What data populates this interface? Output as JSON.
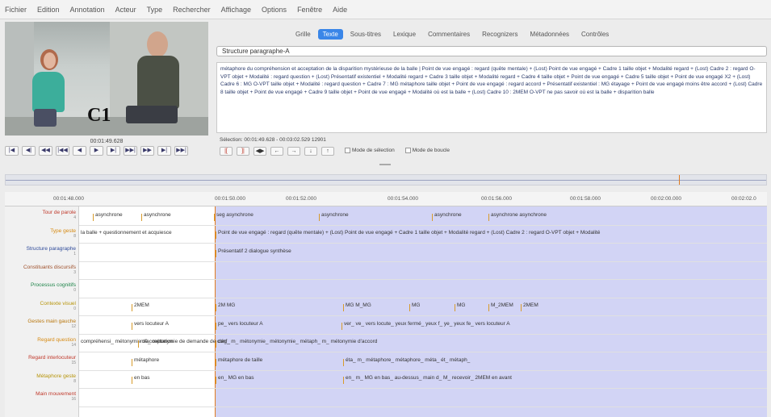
{
  "menu": [
    "Fichier",
    "Edition",
    "Annotation",
    "Acteur",
    "Type",
    "Rechercher",
    "Affichage",
    "Options",
    "Fenêtre",
    "Aide"
  ],
  "video": {
    "caption": "C1",
    "time": "00:01:49.628"
  },
  "transport": [
    "|◀",
    "◀|",
    "◀◀",
    "|◀◀",
    "◀",
    "▶",
    "▶|",
    "▶▶|",
    "▶▶",
    "▶|",
    "▶▶|"
  ],
  "tabs": [
    {
      "label": "Grille",
      "active": false
    },
    {
      "label": "Texte",
      "active": true
    },
    {
      "label": "Sous-titres",
      "active": false
    },
    {
      "label": "Lexique",
      "active": false
    },
    {
      "label": "Commentaires",
      "active": false
    },
    {
      "label": "Recognizers",
      "active": false
    },
    {
      "label": "Métadonnées",
      "active": false
    },
    {
      "label": "Contrôles",
      "active": false
    }
  ],
  "tier_select": "Structure paragraphe-A",
  "text_view": "métaphore du compréhension et acceptation de la disparition mystérieuse de la balle | Point de vue engagé : regard (quête mentale) + (Lost) Point de vue engagé + Cadre 1 taille objet + Modalité regard + (Lost) Cadre 2 : regard O-VPT objet + Modalité : regard question + (Lost) Présentatif existentiel + Modalité regard + Cadre 3 taille objet + Modalité regard + Cadre 4 taille objet + Point de vue engagé + Cadre 5 taille objet + Point de vue engagé X2 + (Lost) Cadre 6 : MG O-VPT taille objet + Modalité : regard question + Cadre 7 : MG métaphore taille objet + Point de vue engagé : regard accord + Présentatif existentiel : MG étayage + Point de vue engagé moins être accord + (Lost) Cadre 8 taille objet + Point de vue engagé + Cadre 9 taille objet + Point de vue engagé + Modalité où est la balle + (Lost) Cadre 10 : 2MEM O-VPT ne pas savoir où est la balle + disparition balle",
  "selection_info": "Sélection: 00:01:49.628 - 00:03:02.529  12901",
  "tools": [
    "|[",
    "]|",
    "◀▶",
    "←",
    "→",
    "↓",
    "↑"
  ],
  "modes": [
    "Mode de sélection",
    "Mode de boucle"
  ],
  "ruler_ticks": [
    "00:01:48.000",
    "00:01:50.000",
    "00:01:52.000",
    "00:01:54.000",
    "00:01:56.000",
    "00:01:58.000",
    "00:02:00.000",
    "00:02:02.0"
  ],
  "tiers": [
    {
      "name": "Tour de parole",
      "count": "4"
    },
    {
      "name": "Type geste",
      "count": "8"
    },
    {
      "name": "Structure paragraphe",
      "count": "1"
    },
    {
      "name": "Constituants discursifs",
      "count": "3"
    },
    {
      "name": "Processus cognitifs",
      "count": "0"
    },
    {
      "name": "Contexte visuel",
      "count": "0"
    },
    {
      "name": "Gestes main gauche",
      "count": "12"
    },
    {
      "name": "Regard question",
      "count": "14"
    },
    {
      "name": "Regard interlocuteur",
      "count": "15"
    },
    {
      "name": "Métaphore geste",
      "count": "8"
    },
    {
      "name": "Main mouvement",
      "count": "16"
    }
  ],
  "annotations": [
    [
      "asynchrone",
      "asynchrone",
      "seg asynchrone",
      "asynchrone",
      "asynchrone",
      "asynchrone asynchrone"
    ],
    [
      "la balle + questionnement et acquiesce",
      "Point de vue engagé : regard (quête mentale) + (Lost) Point de vue engagé + Cadre 1 taille objet + Modalité regard + (Lost) Cadre 2 : regard O-VPT objet + Modalité"
    ],
    [
      "Présentatif 2 dialogue synthèse"
    ],
    [],
    [],
    [
      "2MEM",
      "2M MG",
      "MG M_MG",
      "MG",
      "MG",
      "M_2MEM",
      "2MEM"
    ],
    [
      "vers locuteur A",
      "pe_ vers locuteur A",
      "ver_ ve_ vers locute_ yeux fermé_ yeux f_ ye_ yeux fe_ vers locuteur A"
    ],
    [
      "compréhensi_ métonymie d'acceptation",
      "mé_ métonymie de demande de conf_",
      "dég_ m_ métonymie_ métonymie_ métaph_ m_ métonymie d'accord"
    ],
    [
      "métaphore",
      "métaphore de taille",
      "éta_ m_ métaphore_ métaphore_ méta_ ét_ métaph_"
    ],
    [
      "en bas",
      "en_ MG en bas",
      "en_ m_ MG en bas_ au-dessus_ main d_ M_ recevoir_ 2MEM en avant"
    ]
  ]
}
